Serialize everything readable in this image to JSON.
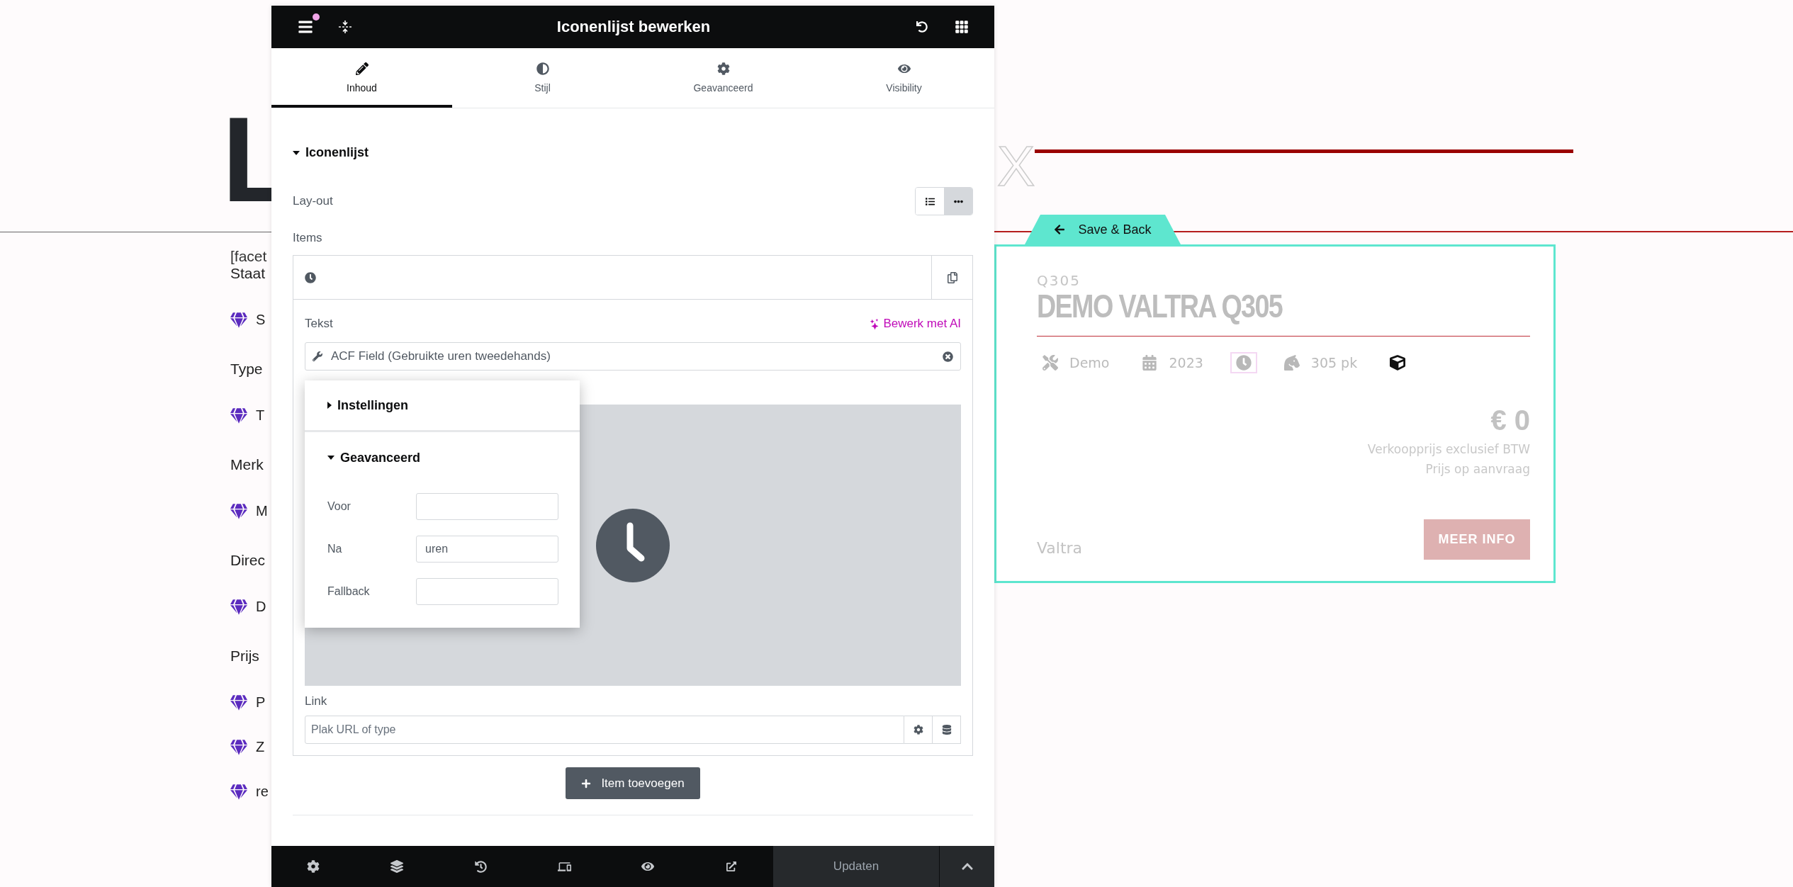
{
  "site": {
    "logo": "L",
    "logo_mark": "X",
    "facet_code": "[facet",
    "filters": [
      {
        "title": "Staat",
        "items": [
          "S"
        ]
      },
      {
        "title": "Type",
        "items": [
          "T"
        ]
      },
      {
        "title": "Merk",
        "items": [
          "M"
        ]
      },
      {
        "title": "Direc",
        "items": [
          "D"
        ]
      },
      {
        "title": "Prijs",
        "items": [
          "P",
          "Z",
          "re"
        ]
      }
    ]
  },
  "card": {
    "save_back": "Save & Back",
    "code": "Q305",
    "title": "DEMO VALTRA Q305",
    "specs": [
      {
        "kind": "type",
        "text": "Demo",
        "selected": false
      },
      {
        "kind": "year",
        "text": "2023",
        "selected": false
      },
      {
        "kind": "hours",
        "selected": true
      },
      {
        "kind": "power",
        "text": "305 pk",
        "selected": false
      },
      {
        "kind": "dimensions",
        "selected": false
      }
    ],
    "price": "€ 0",
    "price_note": "Verkoopprijs exclusief BTW",
    "price_request": "Prijs op aanvraag",
    "brand": "Valtra",
    "more_button": "MEER INFO"
  },
  "editor": {
    "title": "Iconenlijst bewerken",
    "notification": true,
    "tabs": [
      {
        "kind": "content",
        "label": "Inhoud",
        "selected": true
      },
      {
        "kind": "style",
        "label": "Stijl",
        "selected": false
      },
      {
        "kind": "advanced",
        "label": "Geavanceerd",
        "selected": false
      },
      {
        "kind": "visibility",
        "label": "Visibility",
        "selected": false
      }
    ],
    "section": {
      "title": "Iconenlijst",
      "expanded": true
    },
    "layout": {
      "label": "Lay-out",
      "options": [
        {
          "kind": "list",
          "selected": false
        },
        {
          "kind": "inline",
          "selected": true
        }
      ]
    },
    "items_label": "Items",
    "item": {
      "text_label": "Tekst",
      "ai_link": "Bewerk met AI",
      "text_value": "ACF Field (Gebruikte uren tweedehands)",
      "link_label": "Link",
      "link_placeholder": "Plak URL of type"
    },
    "popover": {
      "sections": [
        {
          "title": "Instellingen",
          "expanded": false
        },
        {
          "title": "Geavanceerd",
          "expanded": true,
          "fields": [
            {
              "label": "Voor"
            },
            {
              "label": "Na",
              "value": "uren"
            },
            {
              "label": "Fallback"
            }
          ]
        }
      ]
    },
    "add_button": "Item toevoegen",
    "update_button": "Updaten"
  }
}
